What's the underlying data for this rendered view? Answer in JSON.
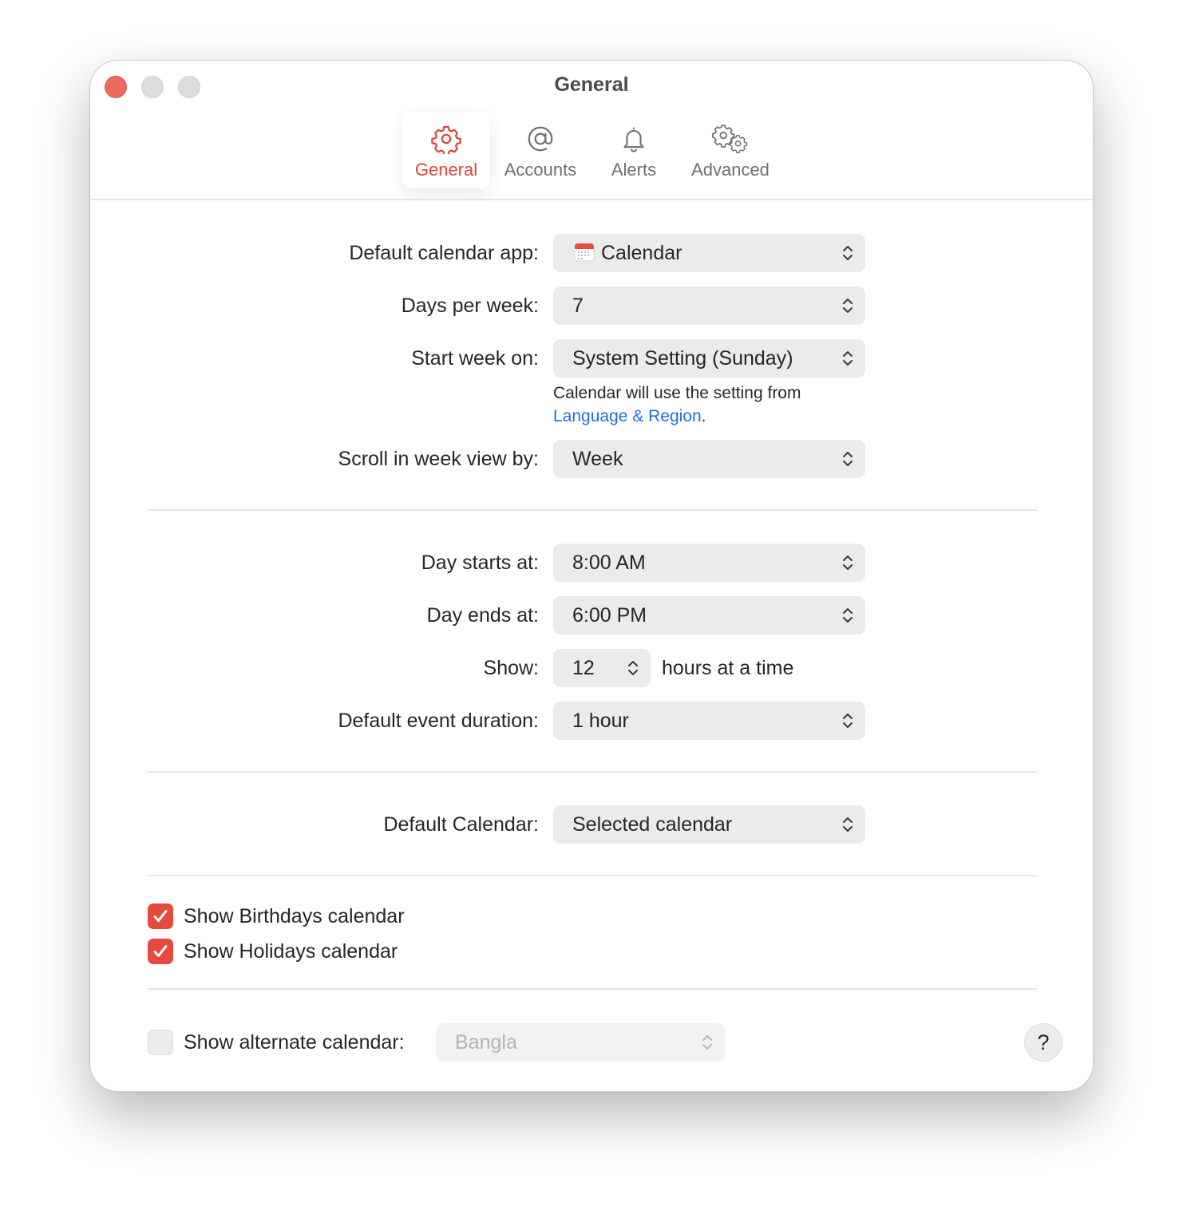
{
  "window": {
    "title": "General"
  },
  "tabs": [
    {
      "label": "General",
      "icon": "gear-icon",
      "active": true
    },
    {
      "label": "Accounts",
      "icon": "at-icon",
      "active": false
    },
    {
      "label": "Alerts",
      "icon": "bell-icon",
      "active": false
    },
    {
      "label": "Advanced",
      "icon": "gears-icon",
      "active": false
    }
  ],
  "general": {
    "default_app": {
      "label": "Default calendar app:",
      "value": "Calendar",
      "icon": "calendar-app-icon"
    },
    "days_per_week": {
      "label": "Days per week:",
      "value": "7"
    },
    "start_week": {
      "label": "Start week on:",
      "value": "System Setting (Sunday)"
    },
    "hint": {
      "text": "Calendar will use the setting from",
      "link": "Language & Region",
      "suffix": "."
    },
    "scroll": {
      "label": "Scroll in week view by:",
      "value": "Week"
    }
  },
  "time": {
    "day_starts": {
      "label": "Day starts at:",
      "value": "8:00 AM"
    },
    "day_ends": {
      "label": "Day ends at:",
      "value": "6:00 PM"
    },
    "show": {
      "label": "Show:",
      "value": "12",
      "suffix": "hours at a time"
    },
    "duration": {
      "label": "Default event duration:",
      "value": "1 hour"
    }
  },
  "default_calendar": {
    "label": "Default Calendar:",
    "value": "Selected calendar"
  },
  "checks": {
    "birthdays": {
      "label": "Show Birthdays calendar",
      "checked": true
    },
    "holidays": {
      "label": "Show Holidays calendar",
      "checked": true
    }
  },
  "alternate": {
    "label": "Show alternate calendar:",
    "value": "Bangla",
    "checked": false
  },
  "help": {
    "label": "?"
  },
  "colors": {
    "accent": "#e0443a",
    "link": "#1f6fd8",
    "popup_bg": "#ebebeb"
  }
}
